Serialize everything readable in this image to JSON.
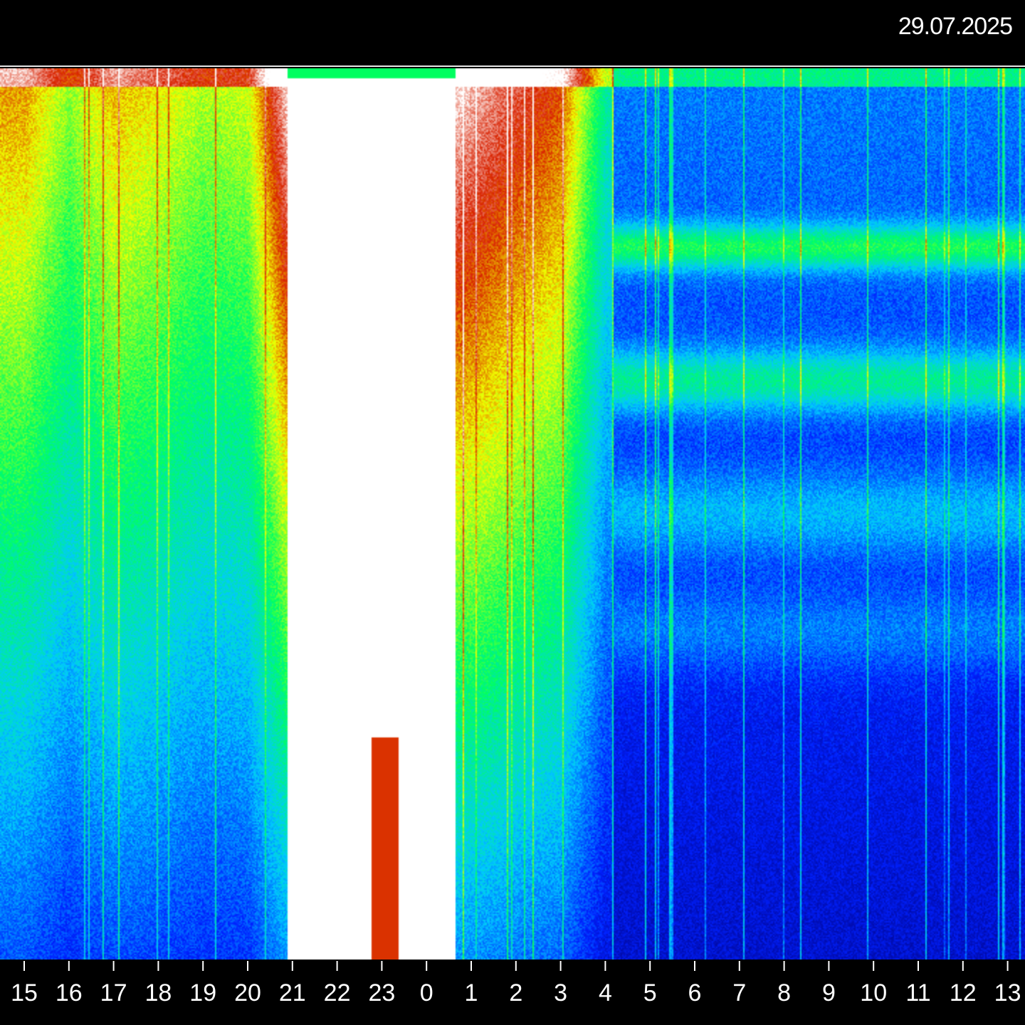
{
  "date": "29.07.2025",
  "chart_data": {
    "type": "heatmap",
    "title": "",
    "xlabel": "",
    "ylabel": "",
    "x_ticks": [
      "15",
      "16",
      "17",
      "18",
      "19",
      "20",
      "21",
      "22",
      "23",
      "0",
      "1",
      "2",
      "3",
      "4",
      "5",
      "6",
      "7",
      "8",
      "9",
      "10",
      "11",
      "12",
      "13"
    ],
    "colormap": [
      "#000080",
      "#0020ff",
      "#00c8ff",
      "#00ff60",
      "#f0ff00",
      "#d82000",
      "#ffffff"
    ],
    "intensity_profile": [
      {
        "tick": "15",
        "level": 0.72
      },
      {
        "tick": "16",
        "level": 0.58
      },
      {
        "tick": "17",
        "level": 0.7
      },
      {
        "tick": "18",
        "level": 0.66
      },
      {
        "tick": "19",
        "level": 0.6
      },
      {
        "tick": "20",
        "level": 0.62
      },
      {
        "tick": "21",
        "level": 1.0
      },
      {
        "tick": "22",
        "level": 1.0
      },
      {
        "tick": "23",
        "level": 1.0
      },
      {
        "tick": "0",
        "level": 1.0
      },
      {
        "tick": "1",
        "level": 0.92
      },
      {
        "tick": "2",
        "level": 0.85
      },
      {
        "tick": "3",
        "level": 0.78
      },
      {
        "tick": "4",
        "level": 0.42
      },
      {
        "tick": "5",
        "level": 0.45
      },
      {
        "tick": "6",
        "level": 0.3
      },
      {
        "tick": "7",
        "level": 0.3
      },
      {
        "tick": "8",
        "level": 0.3
      },
      {
        "tick": "9",
        "level": 0.3
      },
      {
        "tick": "10",
        "level": 0.3
      },
      {
        "tick": "11",
        "level": 0.3
      },
      {
        "tick": "12",
        "level": 0.3
      },
      {
        "tick": "13",
        "level": 0.3
      }
    ],
    "grid": false,
    "legend": "none"
  }
}
